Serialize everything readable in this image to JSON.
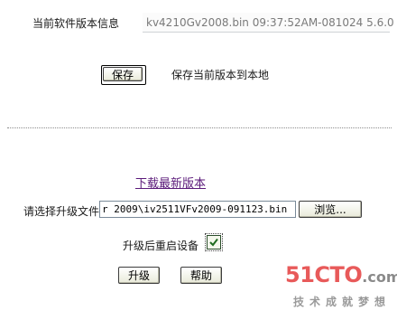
{
  "current_version": {
    "label": "当前软件版本信息",
    "value": "kv4210Gv2008.bin 09:37:52AM-081024 5.6.0"
  },
  "save": {
    "button_label": "保存",
    "description": "保存当前版本到本地"
  },
  "download_link": "下载最新版本",
  "upgrade_file": {
    "label": "请选择升级文件",
    "value": "r 2009\\iv2511VFv2009-091123.bin",
    "browse_label": "浏览..."
  },
  "reboot": {
    "label": "升级后重启设备",
    "checked": true
  },
  "actions": {
    "upgrade_label": "升级",
    "help_label": "帮助"
  },
  "watermark": {
    "logo_main": "51CTO",
    "logo_suffix": ".com",
    "slogan": "技术成就梦想"
  }
}
